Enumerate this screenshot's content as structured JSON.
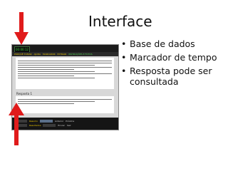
{
  "slide": {
    "title": "Interface",
    "bullets": [
      "Base de dados",
      "Marcador de tempo",
      "Resposta pode ser consultada"
    ]
  },
  "app": {
    "timer": "00:00:12",
    "toolbar": [
      "PORQUÊ TOMAR",
      "AJUDA",
      "MARCADOR",
      "EXTRAIR",
      "INSTRUÇÕES E FOTOS"
    ],
    "answer_label": "Resposta 1",
    "bottom_row_1": [
      "Resumo",
      "Anterior",
      "Próxima"
    ],
    "bottom_row_2": [
      "Resultados",
      "Enviar",
      "Sair"
    ]
  },
  "colors": {
    "arrow": "#e01b1b",
    "timer_text": "#3fd23f",
    "toolbar_accent": "#e8c400"
  }
}
